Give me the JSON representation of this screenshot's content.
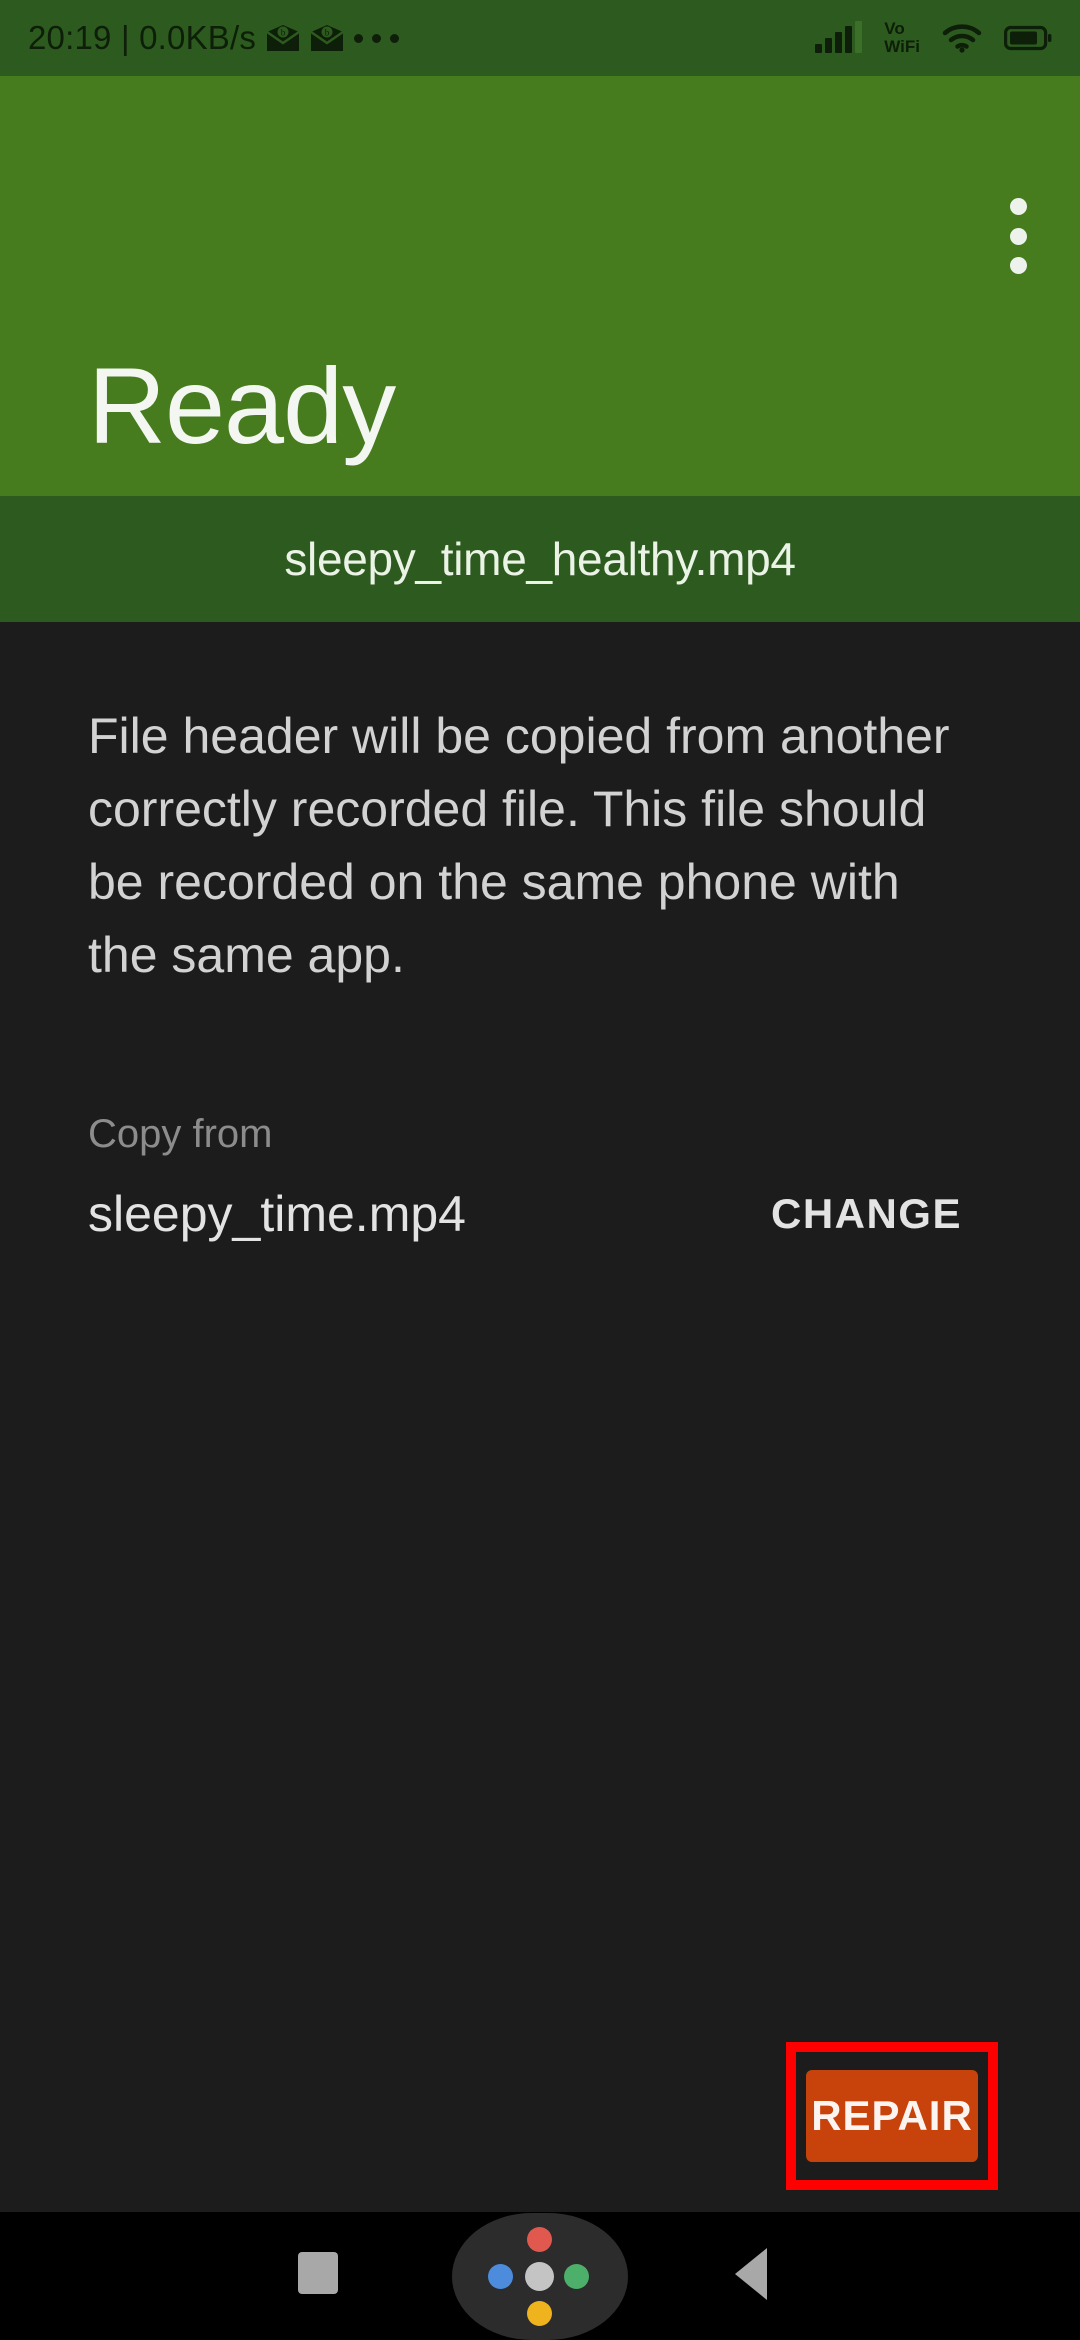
{
  "status_bar": {
    "time_and_rate": "20:19 | 0.0KB/s",
    "notification_icons": [
      "mail-icon",
      "mail-icon"
    ],
    "overflow_indicator": "more-notifications-dots",
    "signal_icon": "cellular-signal-icon",
    "volte_label_line1": "Vo",
    "volte_label_line2": "WiFi",
    "wifi_icon": "wifi-icon",
    "battery_icon": "battery-icon",
    "background_color": "#2d5a1e",
    "foreground_color": "#0d1f08"
  },
  "header": {
    "title": "Ready",
    "overflow_menu": "more-options-menu",
    "background_color": "#467c1e",
    "title_color": "#f3f6f1"
  },
  "filename_bar": {
    "filename": "sleepy_time_healthy.mp4",
    "background_color": "#2d5a1e",
    "text_color": "#eaf3e5"
  },
  "content": {
    "description": "File header will be copied from another correctly recorded file. This file should be recorded on the same phone with the same app.",
    "copy_from_label": "Copy from",
    "source_file": "sleepy_time.mp4",
    "change_label": "CHANGE",
    "background_color": "#1c1c1c",
    "description_color": "#d2d2d2",
    "label_color": "#8c8c8c"
  },
  "actions": {
    "repair_label": "REPAIR",
    "repair_button_color": "#c8430b",
    "repair_text_color": "#fbf4f0",
    "highlight_outline_color": "#fe0000"
  },
  "nav_bar": {
    "recents_icon": "recents-square-icon",
    "assistant_icon": "google-assistant-icon",
    "back_icon": "back-triangle-icon",
    "background_color": "#000000",
    "icon_color": "#a8a8a8",
    "assistant_dots": [
      {
        "name": "red-dot",
        "color": "#e0584e"
      },
      {
        "name": "blue-dot",
        "color": "#4d8cdd"
      },
      {
        "name": "grey-dot",
        "color": "#c4c4c4"
      },
      {
        "name": "green-dot",
        "color": "#4caf6a"
      },
      {
        "name": "yellow-dot",
        "color": "#efb31e"
      }
    ]
  }
}
